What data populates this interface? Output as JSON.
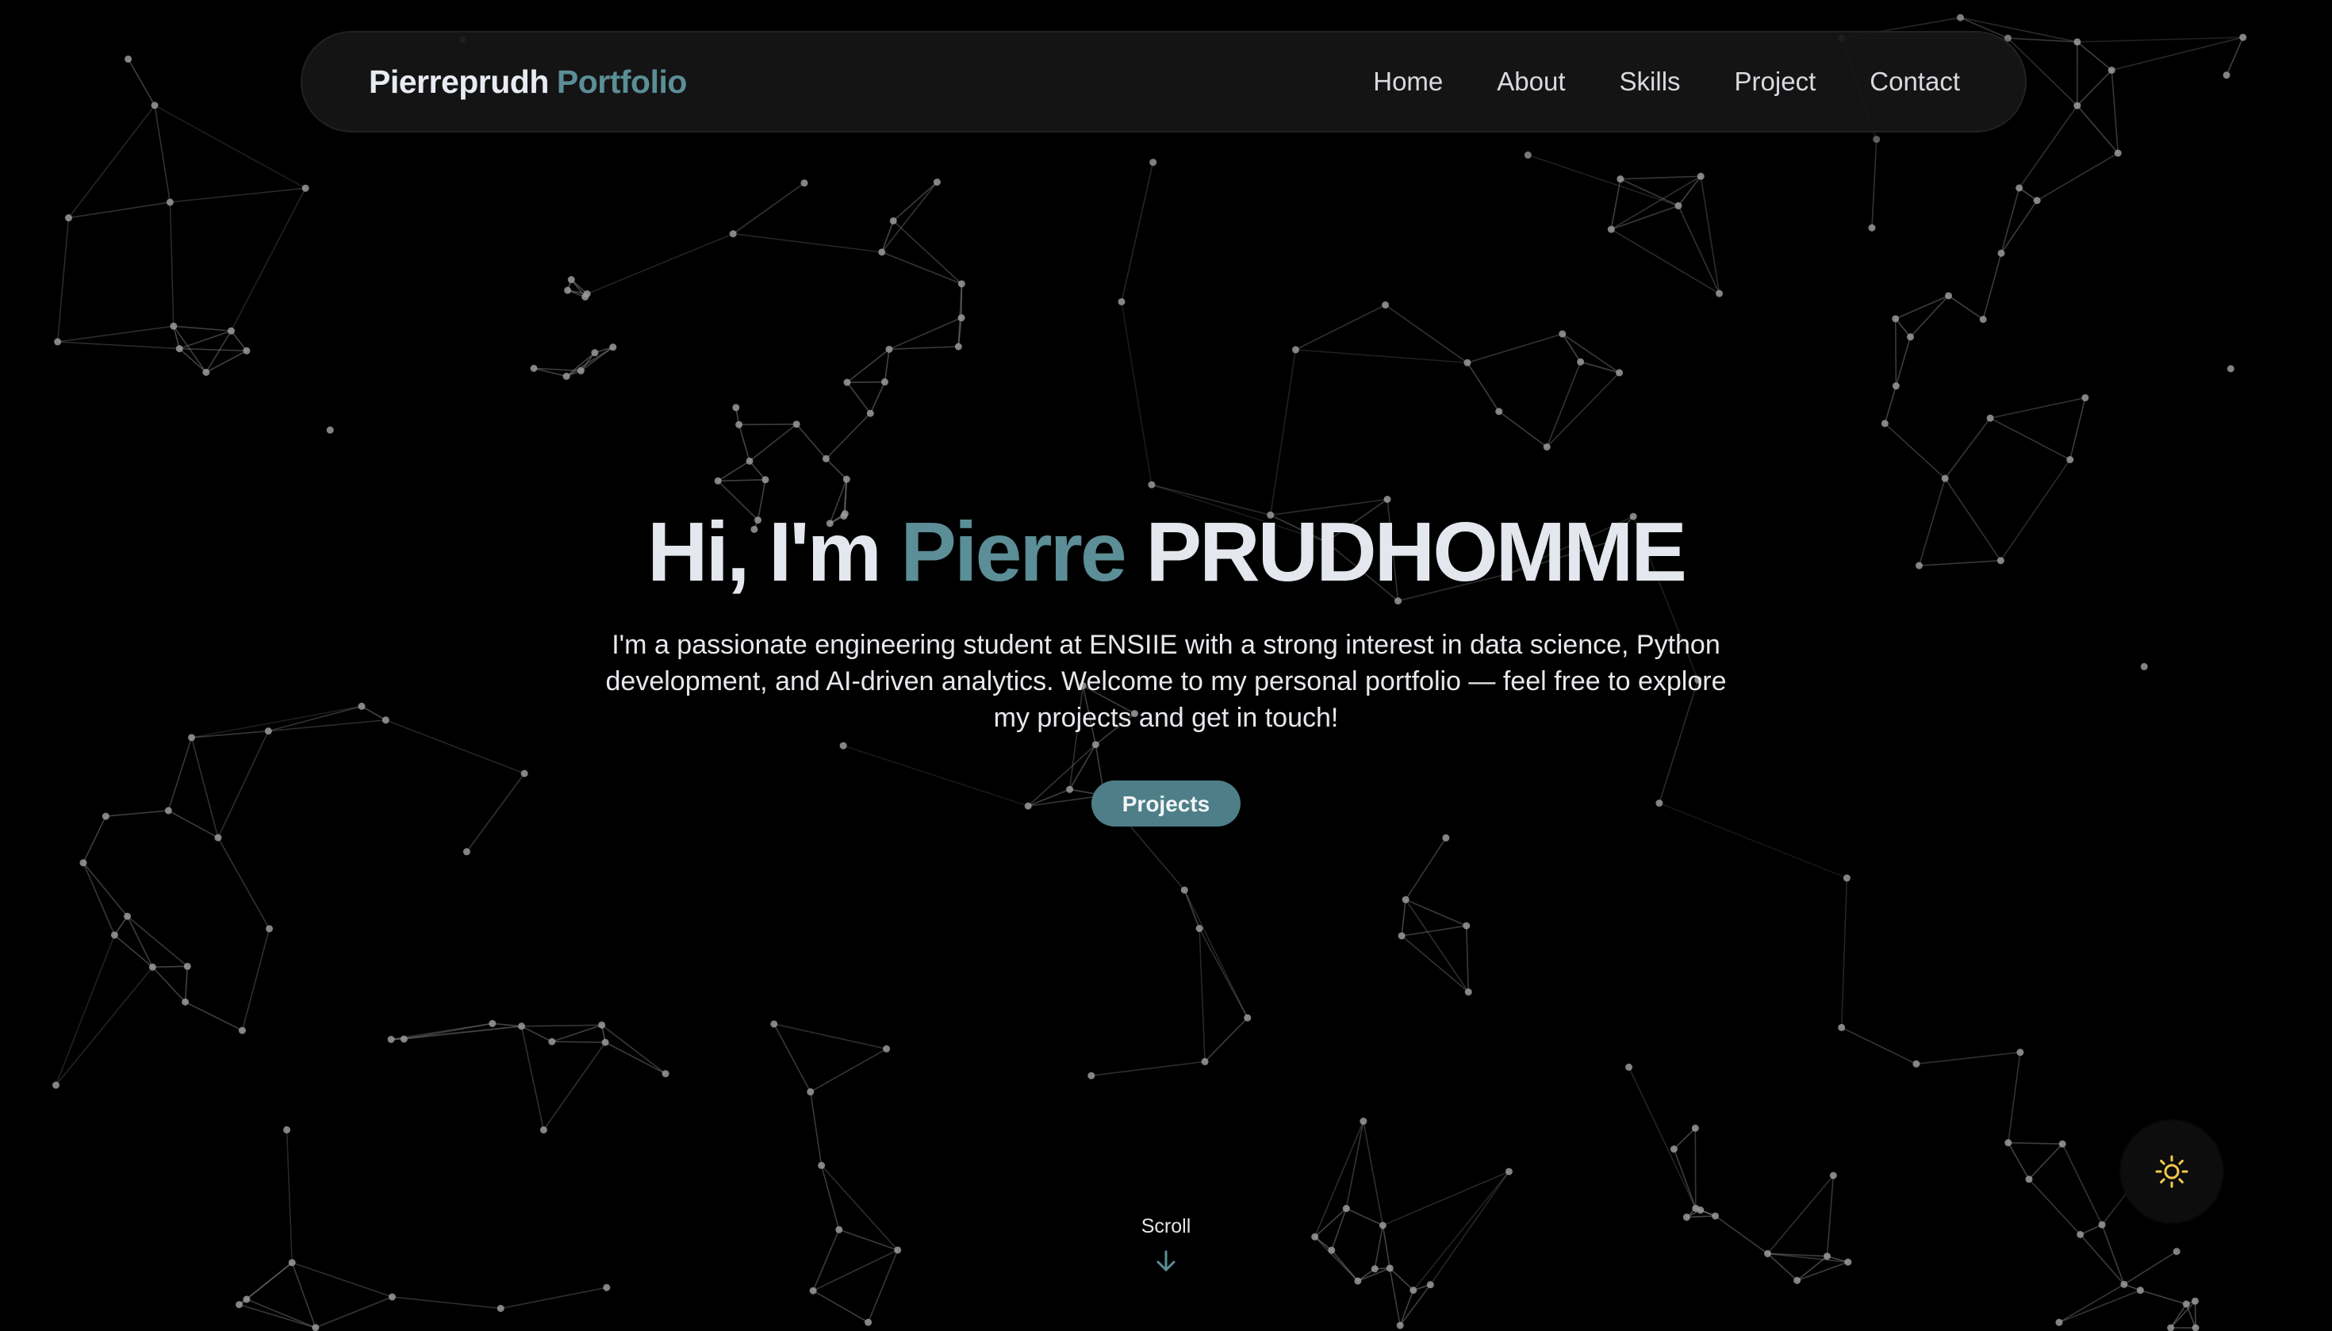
{
  "brand": {
    "main": "Pierreprudh",
    "accent": "Portfolio"
  },
  "nav": {
    "items": [
      {
        "label": "Home"
      },
      {
        "label": "About"
      },
      {
        "label": "Skills"
      },
      {
        "label": "Project"
      },
      {
        "label": "Contact"
      }
    ]
  },
  "hero": {
    "greeting": "Hi, I'm",
    "first_name": "Pierre",
    "last_name": "PRUDHOMME",
    "description": "I'm a passionate engineering student at ENSIIE with a strong interest in data science, Python development, and AI-driven analytics. Welcome to my personal portfolio — feel free to explore my projects and get in touch!",
    "cta_label": "Projects"
  },
  "scroll": {
    "label": "Scroll",
    "icon": "arrow-down-icon"
  },
  "theme_toggle": {
    "icon": "sun-icon"
  },
  "colors": {
    "background": "#000000",
    "accent": "#5b8e96",
    "button": "#4e7f88",
    "sun": "#f2c94c",
    "network_line": "#8a8a8a",
    "network_node": "#9a9a9a"
  }
}
